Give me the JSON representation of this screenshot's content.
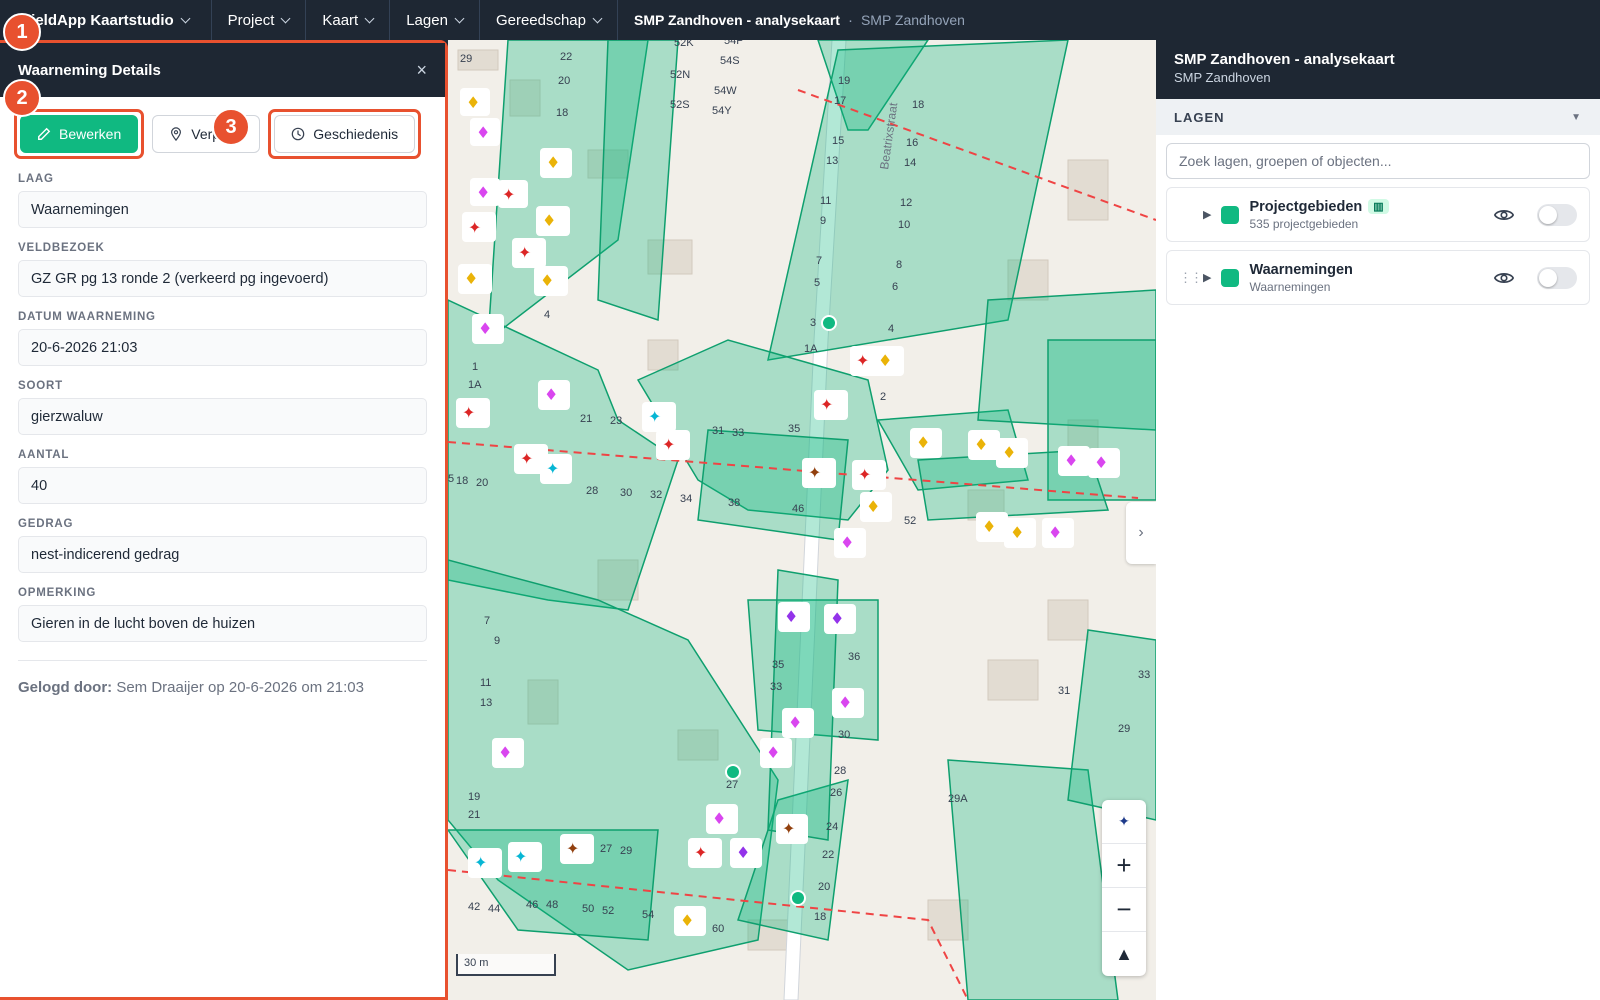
{
  "topbar": {
    "brand": "FieldApp Kaartstudio",
    "menus": [
      "Project",
      "Kaart",
      "Lagen",
      "Gereedschap"
    ],
    "crumb_title": "SMP Zandhoven - analysekaart",
    "crumb_sep": "·",
    "crumb_sub": "SMP Zandhoven"
  },
  "detail_panel": {
    "title": "Waarneming Details",
    "close": "×",
    "buttons": {
      "edit": "Bewerken",
      "move": "Verp",
      "history": "Geschiedenis"
    },
    "fields": [
      {
        "label": "LAAG",
        "value": "Waarnemingen"
      },
      {
        "label": "VELDBEZOEK",
        "value": "GZ GR pg 13 ronde 2 (verkeerd pg ingevoerd)"
      },
      {
        "label": "DATUM WAARNEMING",
        "value": "20-6-2026 21:03"
      },
      {
        "label": "SOORT",
        "value": "gierzwaluw"
      },
      {
        "label": "AANTAL",
        "value": "40"
      },
      {
        "label": "GEDRAG",
        "value": "nest-indicerend gedrag"
      },
      {
        "label": "OPMERKING",
        "value": "Gieren in de lucht boven de huizen"
      }
    ],
    "logged_label": "Gelogd door:",
    "logged_value": "Sem Draaijer op 20-6-2026 om 21:03"
  },
  "steps": [
    "1",
    "2",
    "3"
  ],
  "map": {
    "scale": "30 m",
    "street": "Beatrixstraat",
    "house_numbers": [
      "22",
      "20",
      "18",
      "29",
      "19",
      "17",
      "18",
      "15",
      "16",
      "13",
      "14",
      "11",
      "12",
      "9",
      "10",
      "7",
      "8",
      "5",
      "6",
      "3",
      "4",
      "1A",
      "2",
      "1",
      "1A",
      "21",
      "23",
      "31",
      "33",
      "35",
      "38",
      "46",
      "52",
      "5",
      "18",
      "20",
      "28",
      "30",
      "32",
      "34",
      "7",
      "9",
      "11",
      "13",
      "19",
      "21",
      "35",
      "33",
      "36",
      "30",
      "28",
      "26",
      "27",
      "24",
      "22",
      "20",
      "18",
      "42",
      "44",
      "46",
      "48",
      "50",
      "52",
      "54",
      "60",
      "27",
      "29",
      "29A",
      "31",
      "29",
      "33",
      "4",
      "52K",
      "54P",
      "54S",
      "52N",
      "54W",
      "52S",
      "54Y"
    ],
    "zoom_in": "+",
    "zoom_out": "−",
    "north": "▲"
  },
  "layers_panel": {
    "title": "SMP Zandhoven - analysekaart",
    "subtitle": "SMP Zandhoven",
    "section": "LAGEN",
    "search_placeholder": "Zoek lagen, groepen of objecten...",
    "layers": [
      {
        "name": "Projectgebieden",
        "sub": "535 projectgebieden"
      },
      {
        "name": "Waarnemingen",
        "sub": "Waarnemingen"
      }
    ]
  },
  "colors": {
    "accent": "#10b981",
    "highlight": "#e8512f",
    "header": "#1e2733"
  }
}
